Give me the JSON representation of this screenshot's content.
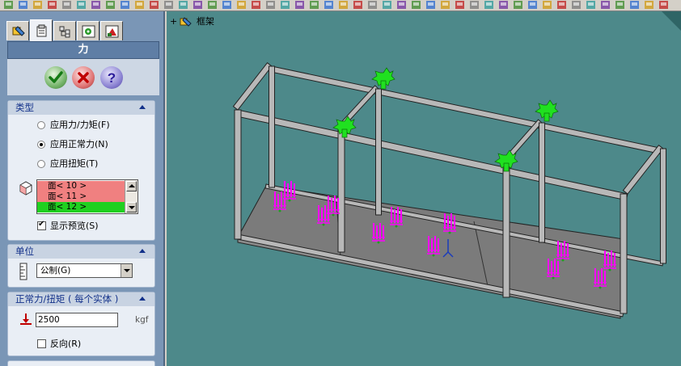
{
  "panel": {
    "title": "力",
    "tabs": [
      "feature-manager-tab",
      "property-manager-tab",
      "configuration-manager-tab",
      "dimxpert-tab",
      "display-manager-tab"
    ],
    "buttons": {
      "ok": "ok",
      "cancel": "cancel",
      "help": "help"
    }
  },
  "type_group": {
    "header": "类型",
    "options": [
      "应用力/力矩(F)",
      "应用正常力(N)",
      "应用扭矩(T)"
    ],
    "selected_index": 1,
    "faces": [
      "面< 10 >",
      "面< 11 >",
      "面< 12 >"
    ],
    "faces_colors": [
      "#f08080",
      "#f08080",
      "#20d020"
    ],
    "show_preview_label": "显示预览(S)",
    "show_preview_checked": true
  },
  "units_group": {
    "header": "单位",
    "value": "公制(G)"
  },
  "force_group": {
    "header": "正常力/扭矩 ( 每个实体 )",
    "value": "2500",
    "unit": "kgf",
    "reverse_label": "反向(R)",
    "reverse_checked": false
  },
  "viewport": {
    "tree_expand": "+",
    "tree_label": "框架",
    "background": "#4d898a",
    "frame_color": "#b8b8b8",
    "floor_color": "#7b7b7b",
    "fixture_color": "#20e020",
    "load_color": "#ff00ff"
  }
}
